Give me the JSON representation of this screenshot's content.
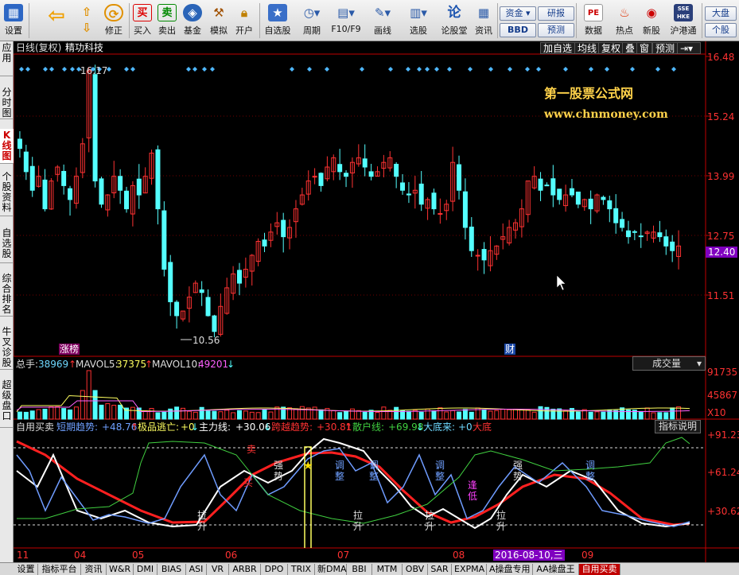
{
  "toolbar": {
    "buttons": [
      {
        "label": "设置"
      },
      {
        "label": ""
      },
      {
        "label": "修正"
      },
      {
        "label": "买入",
        "glyph": "买"
      },
      {
        "label": "卖出",
        "glyph": "卖"
      },
      {
        "label": "基金"
      },
      {
        "label": "模拟"
      },
      {
        "label": "开户"
      },
      {
        "label": "自选股"
      },
      {
        "label": "周期"
      },
      {
        "label": "F10/F9"
      },
      {
        "label": "画线"
      },
      {
        "label": "选股"
      },
      {
        "label": "论股堂",
        "glyph": "论"
      },
      {
        "label": "资讯"
      },
      {
        "label": "数据",
        "glyph": "PE"
      },
      {
        "label": "热点"
      },
      {
        "label": "新股"
      },
      {
        "label": "沪港通",
        "glyph": "SSE HKE"
      }
    ],
    "mini": {
      "zijin": "资金",
      "bbd": "BBD",
      "yanbao": "研报",
      "yuce": "预测",
      "dapan": "大盘",
      "gegu": "个股"
    }
  },
  "vtabs": [
    "应用",
    "分时图",
    "K线图",
    "个股资料",
    "自选股",
    "综合排名",
    "牛叉诊股",
    "超级盘口"
  ],
  "kline": {
    "title": "日线(复权)",
    "stock": "精功科技",
    "buttons": [
      "加自选",
      "均线",
      "复权",
      "叠",
      "窗",
      "预测"
    ],
    "price_axis": [
      "16.48",
      "15.24",
      "13.99",
      "12.75",
      "11.51"
    ],
    "current_price": "12.40",
    "high_label": "16.17",
    "low_label": "10.56",
    "watermark_title": "第一股票公式网",
    "watermark_url": "www.chnmoney.com",
    "tag_zhangbang": "涨榜",
    "tag_cai": "财"
  },
  "volume": {
    "total_label": "总手:",
    "total_value": "38969",
    "ma5_label": "MAVOL5:",
    "ma5_value": "37375",
    "ma10_label": "MAVOL10:",
    "ma10_value": "49201",
    "selector": "成交量",
    "axis": [
      "91735",
      "45867"
    ],
    "unit": "X10"
  },
  "indicator": {
    "name": "自用买卖",
    "trend_label": "短期趋势:",
    "trend_value": "+48.76",
    "escape_label": "极品逃亡:",
    "escape_value": "+0",
    "main_label": "主力线:",
    "main_value": "+30.06",
    "cross_label": "跨越趋势:",
    "cross_value": "+30.81",
    "retail_label": "散户线:",
    "retail_value": "+69.98",
    "big_label": "大底来:",
    "big_value": "+0",
    "big_extra": "大底",
    "help": "指标说明",
    "axis": [
      "+91.23",
      "+61.24",
      "+30.62"
    ],
    "labels": [
      "拉升",
      "卖",
      "买",
      "强势",
      "调整",
      "调整",
      "拉升",
      "拉升",
      "调整",
      "逢低",
      "强势",
      "拉升",
      "调整"
    ]
  },
  "date_axis": {
    "labels": [
      "11",
      "04",
      "05",
      "06",
      "07",
      "08",
      "09"
    ],
    "highlight": "2016-08-10,三"
  },
  "bottom_tabs": [
    "设置",
    "指标平台",
    "资讯",
    "W&R",
    "DMI",
    "BIAS",
    "ASI",
    "VR",
    "ARBR",
    "DPO",
    "TRIX",
    "新DMA",
    "BBI",
    "MTM",
    "OBV",
    "SAR",
    "EXPMA",
    "A操盘专用",
    "AA操盘王",
    "自用买卖"
  ],
  "colors": {
    "up": "#ff3232",
    "down": "#54ffff",
    "bg": "#000000",
    "axis": "#c00000"
  }
}
